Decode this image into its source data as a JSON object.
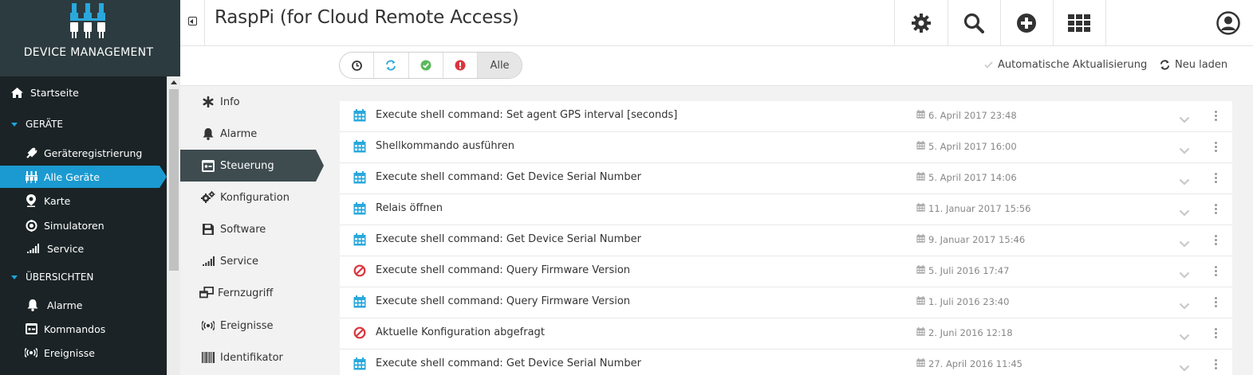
{
  "app": {
    "brand": "DEVICE MANAGEMENT",
    "page_title": "RaspPi (for Cloud Remote Access)"
  },
  "nav": {
    "items": [
      {
        "label": "Startseite",
        "icon": "home-icon"
      },
      {
        "label": "GERÄTE",
        "section": true
      },
      {
        "label": "Geräteregistrierung",
        "icon": "plug-icon"
      },
      {
        "label": "Alle Geräte",
        "icon": "devices-icon",
        "active": true
      },
      {
        "label": "Karte",
        "icon": "map-pin-icon"
      },
      {
        "label": "Simulatoren",
        "icon": "simulator-icon"
      },
      {
        "label": "Service",
        "icon": "signal-icon"
      },
      {
        "label": "ÜBERSICHTEN",
        "section": true
      },
      {
        "label": "Alarme",
        "icon": "bell-icon"
      },
      {
        "label": "Kommandos",
        "icon": "command-icon"
      },
      {
        "label": "Ereignisse",
        "icon": "broadcast-icon"
      }
    ]
  },
  "header": {
    "buttons": [
      "gear-icon",
      "search-icon",
      "plus-circle-icon",
      "apps-grid-icon",
      "user-icon"
    ]
  },
  "filterbar": {
    "filters": [
      "clock-icon",
      "refresh-icon",
      "check-circle-icon",
      "alert-circle-icon"
    ],
    "all_label": "Alle",
    "auto_refresh_label": "Automatische Aktualisierung",
    "reload_label": "Neu laden"
  },
  "submenu": {
    "items": [
      {
        "label": "Info",
        "icon": "asterisk-icon"
      },
      {
        "label": "Alarme",
        "icon": "bell-icon"
      },
      {
        "label": "Steuerung",
        "icon": "control-icon",
        "active": true
      },
      {
        "label": "Konfiguration",
        "icon": "cogs-icon"
      },
      {
        "label": "Software",
        "icon": "floppy-icon"
      },
      {
        "label": "Service",
        "icon": "signal-icon"
      },
      {
        "label": "Fernzugriff",
        "icon": "remote-icon"
      },
      {
        "label": "Ereignisse",
        "icon": "broadcast-icon"
      },
      {
        "label": "Identifikator",
        "icon": "barcode-icon"
      }
    ]
  },
  "operations": [
    {
      "title": "Execute shell command: Set agent GPS interval [seconds]",
      "date": "6. April 2017 23:48",
      "status": "pending"
    },
    {
      "title": "Shellkommando ausführen",
      "date": "5. April 2017 16:00",
      "status": "pending"
    },
    {
      "title": "Execute shell command: Get Device Serial Number",
      "date": "5. April 2017 14:06",
      "status": "pending"
    },
    {
      "title": "Relais öffnen",
      "date": "11. Januar 2017 15:56",
      "status": "pending"
    },
    {
      "title": "Execute shell command: Get Device Serial Number",
      "date": "9. Januar 2017 15:46",
      "status": "pending"
    },
    {
      "title": "Execute shell command: Query Firmware Version",
      "date": "5. Juli 2016 17:47",
      "status": "failed"
    },
    {
      "title": "Execute shell command: Query Firmware Version",
      "date": "1. Juli 2016 23:40",
      "status": "pending"
    },
    {
      "title": "Aktuelle Konfiguration abgefragt",
      "date": "2. Juni 2016 12:18",
      "status": "failed"
    },
    {
      "title": "Execute shell command: Get Device Serial Number",
      "date": "27. April 2016 11:45",
      "status": "pending"
    }
  ],
  "colors": {
    "accent": "#1b9ad1",
    "sidebar_bg": "#2c3b3f",
    "nav_bg": "#1b2326",
    "failed": "#d9363e",
    "success": "#5cb85c"
  }
}
